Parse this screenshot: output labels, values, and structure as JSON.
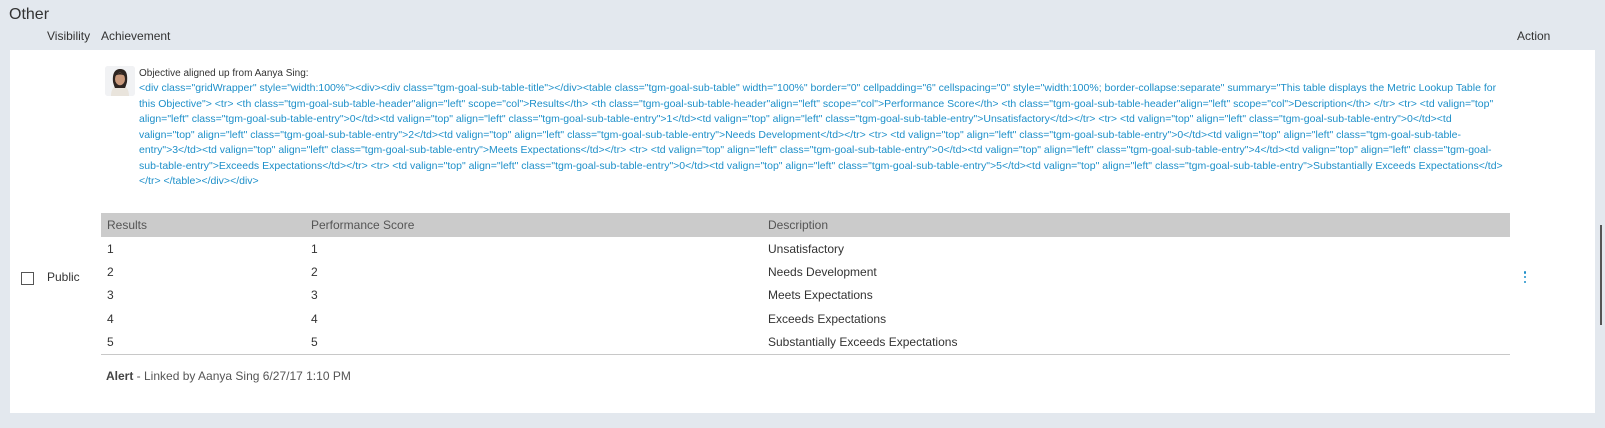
{
  "section": {
    "title": "Other"
  },
  "columns": {
    "visibility": "Visibility",
    "achievement": "Achievement",
    "action": "Action"
  },
  "row": {
    "visibility": "Public",
    "aligned_label": "Objective aligned up from Aanya Sing:",
    "raw_html_text": "<div class=\"gridWrapper\" style=\"width:100%\"><div><div class=\"tgm-goal-sub-table-title\"></div><table class=\"tgm-goal-sub-table\" width=\"100%\" border=\"0\" cellpadding=\"6\" cellspacing=\"0\" style=\"width:100%; border-collapse:separate\" summary=\"This table displays the Metric Lookup Table for this Objective\"> <tr> <th class=\"tgm-goal-sub-table-header\"align=\"left\" scope=\"col\">Results</th> <th class=\"tgm-goal-sub-table-header\"align=\"left\" scope=\"col\">Performance Score</th> <th class=\"tgm-goal-sub-table-header\"align=\"left\" scope=\"col\">Description</th> </tr> <tr> <td valign=\"top\" align=\"left\" class=\"tgm-goal-sub-table-entry\">0</td><td valign=\"top\" align=\"left\" class=\"tgm-goal-sub-table-entry\">1</td><td valign=\"top\" align=\"left\" class=\"tgm-goal-sub-table-entry\">Unsatisfactory</td></tr> <tr> <td valign=\"top\" align=\"left\" class=\"tgm-goal-sub-table-entry\">0</td><td valign=\"top\" align=\"left\" class=\"tgm-goal-sub-table-entry\">2</td><td valign=\"top\" align=\"left\" class=\"tgm-goal-sub-table-entry\">Needs Development</td></tr> <tr> <td valign=\"top\" align=\"left\" class=\"tgm-goal-sub-table-entry\">0</td><td valign=\"top\" align=\"left\" class=\"tgm-goal-sub-table-entry\">3</td><td valign=\"top\" align=\"left\" class=\"tgm-goal-sub-table-entry\">Meets Expectations</td></tr> <tr> <td valign=\"top\" align=\"left\" class=\"tgm-goal-sub-table-entry\">0</td><td valign=\"top\" align=\"left\" class=\"tgm-goal-sub-table-entry\">4</td><td valign=\"top\" align=\"left\" class=\"tgm-goal-sub-table-entry\">Exceeds Expectations</td></tr> <tr> <td valign=\"top\" align=\"left\" class=\"tgm-goal-sub-table-entry\">0</td><td valign=\"top\" align=\"left\" class=\"tgm-goal-sub-table-entry\">5</td><td valign=\"top\" align=\"left\" class=\"tgm-goal-sub-table-entry\">Substantially Exceeds Expectations</td></tr> </table></div></div>",
    "metric_table": {
      "headers": [
        "Results",
        "Performance Score",
        "Description"
      ],
      "rows": [
        [
          "1",
          "1",
          "Unsatisfactory"
        ],
        [
          "2",
          "2",
          "Needs Development"
        ],
        [
          "3",
          "3",
          "Meets Expectations"
        ],
        [
          "4",
          "4",
          "Exceeds Expectations"
        ],
        [
          "5",
          "5",
          "Substantially Exceeds Expectations"
        ]
      ]
    },
    "linked": {
      "type": "Alert",
      "text": " - Linked by Aanya Sing 6/27/17 1:10 PM"
    }
  },
  "icons": {
    "avatar": "user-avatar",
    "action": "more-vertical-icon"
  },
  "colors": {
    "link_blue": "#1d8fc9",
    "page_bg": "#e3e8ee",
    "table_header_bg": "#cbcbcb"
  }
}
